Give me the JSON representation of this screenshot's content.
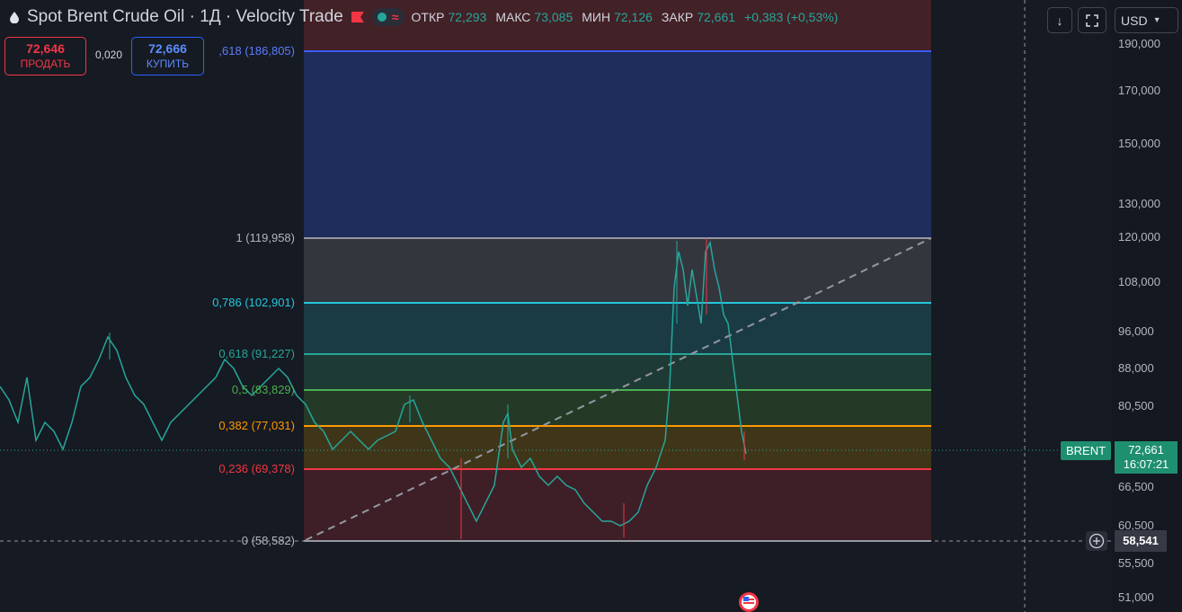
{
  "header": {
    "symbol_title": "Spot Brent Crude Oil · 1Д · Velocity Trade",
    "ohlc": [
      {
        "key": "ОТКР",
        "value": "72,293"
      },
      {
        "key": "МАКС",
        "value": "73,085"
      },
      {
        "key": "МИН",
        "value": "72,126"
      },
      {
        "key": "ЗАКР",
        "value": "72,661"
      }
    ],
    "change": "+0,383 (+0,53%)"
  },
  "trade": {
    "sell_price": "72,646",
    "sell_label": "ПРОДАТЬ",
    "spread": "0,020",
    "buy_price": "72,666",
    "buy_label": "КУПИТЬ"
  },
  "toolbar": {
    "currency": "USD"
  },
  "fib_levels": [
    {
      "label": ",618 (186,805)",
      "ratio": "1.618",
      "price": 186.805,
      "color": "#3d5afe"
    },
    {
      "label": "1 (119,958)",
      "ratio": "1",
      "price": 119.958,
      "color": "#9598a1"
    },
    {
      "label": "0,786 (102,901)",
      "ratio": "0.786",
      "price": 102.901,
      "color": "#26c6da"
    },
    {
      "label": "0,618 (91,227)",
      "ratio": "0.618",
      "price": 91.227,
      "color": "#26a69a"
    },
    {
      "label": "0,5 (83,829)",
      "ratio": "0.5",
      "price": 83.829,
      "color": "#4caf50"
    },
    {
      "label": "0,382 (77,031)",
      "ratio": "0.382",
      "price": 77.031,
      "color": "#ff9800"
    },
    {
      "label": "0,236 (69,378)",
      "ratio": "0.236",
      "price": 69.378,
      "color": "#f23645"
    },
    {
      "label": "0 (58,582)",
      "ratio": "0",
      "price": 58.582,
      "color": "#9598a1"
    }
  ],
  "price_axis": {
    "ticks": [
      "190,000",
      "170,000",
      "150,000",
      "130,000",
      "120,000",
      "108,000",
      "96,000",
      "88,000",
      "80,500",
      "72,661",
      "66,500",
      "60,500",
      "55,500",
      "51,000"
    ]
  },
  "last_price": {
    "symbol": "BRENT",
    "price": "72,661",
    "countdown": "16:07:21"
  },
  "crosshair": {
    "price": "58,541"
  },
  "colors": {
    "up": "#26a69a",
    "down": "#f23645",
    "background": "#161a22"
  }
}
